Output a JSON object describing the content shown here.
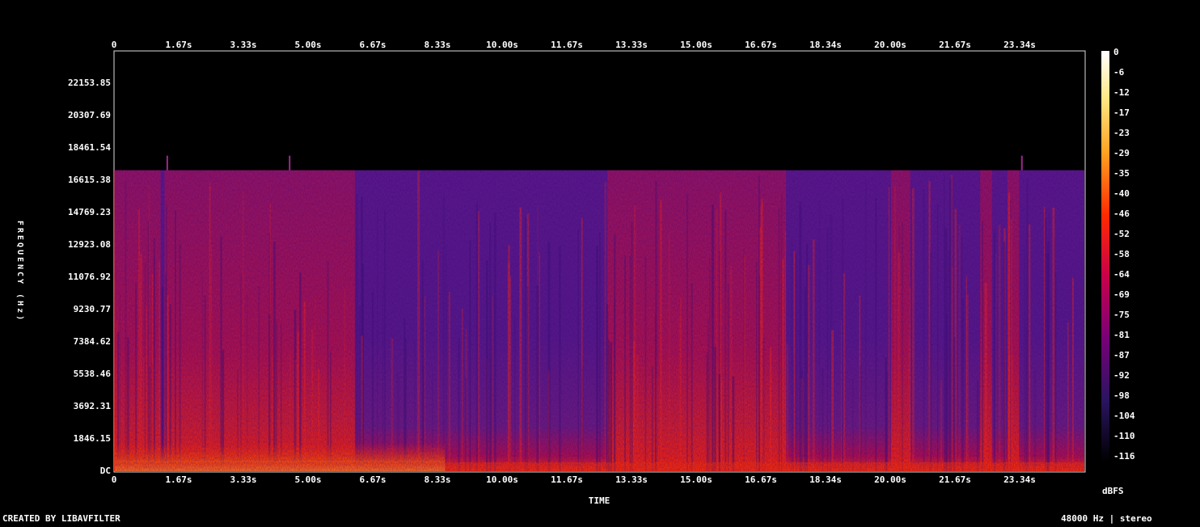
{
  "chart_data": {
    "type": "heatmap",
    "title": "",
    "xlabel": "TIME",
    "ylabel": "FREQUENCY (Hz)",
    "x_ticks": [
      "0",
      "1.67s",
      "3.33s",
      "5.00s",
      "6.67s",
      "8.33s",
      "10.00s",
      "11.67s",
      "13.33s",
      "15.00s",
      "16.67s",
      "18.34s",
      "20.00s",
      "21.67s",
      "23.34s"
    ],
    "y_ticks": [
      "DC",
      "1846.15",
      "3692.31",
      "5538.46",
      "7384.62",
      "9230.77",
      "11076.92",
      "12923.08",
      "14769.23",
      "16615.38",
      "18461.54",
      "20307.69",
      "22153.85"
    ],
    "x_range_s": [
      0,
      25
    ],
    "y_range_hz": [
      0,
      24000
    ],
    "colorbar": {
      "label": "dBFS",
      "ticks": [
        "0",
        "-6",
        "-12",
        "-17",
        "-23",
        "-29",
        "-35",
        "-40",
        "-46",
        "-52",
        "-58",
        "-64",
        "-69",
        "-75",
        "-81",
        "-87",
        "-92",
        "-98",
        "-104",
        "-110",
        "-116"
      ]
    },
    "energy_cutoff_hz": 17200,
    "bright_intervals_s": [
      [
        0.0,
        1.2
      ],
      [
        1.3,
        3.0
      ],
      [
        3.0,
        4.5
      ],
      [
        4.5,
        6.2
      ],
      [
        12.7,
        14.0
      ],
      [
        14.0,
        16.7
      ],
      [
        16.7,
        17.3
      ],
      [
        20.0,
        20.5
      ],
      [
        22.3,
        22.6
      ],
      [
        23.0,
        23.3
      ]
    ]
  },
  "footer": {
    "left": "CREATED BY LIBAVFILTER",
    "right": "48000 Hz | stereo"
  }
}
